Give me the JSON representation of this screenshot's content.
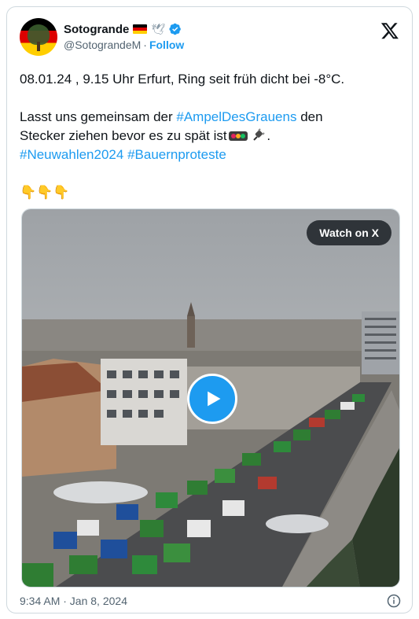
{
  "author": {
    "display_name": "Sotogrande",
    "handle": "@SotograndeM",
    "separator": "·",
    "follow_label": "Follow",
    "avatar_icon": "avatar-tree-german-flag",
    "flag_icon": "german-flag-emoji",
    "dove_icon": "dove-emoji",
    "verified_icon": "verified-badge-icon"
  },
  "tweet": {
    "line1": "08.01.24 , 9.15 Uhr Erfurt, Ring seit früh dicht bei -8°C.",
    "line2_pre": "Lasst uns gemeinsam der ",
    "line2_hashtag": "#AmpelDesGrauens",
    "line2_post": " den",
    "line3": "Stecker ziehen bevor es zu spät ist",
    "line3_end": ".",
    "hashtag1": "#Neuwahlen2024",
    "hashtag2": "#Bauernproteste",
    "traffic_light_icon": "traffic-light-emoji",
    "plug_icon": "electric-plug-emoji",
    "pointing_emoji": "👇👇👇"
  },
  "media": {
    "watch_label": "Watch on X",
    "play_icon": "play-icon"
  },
  "footer": {
    "timestamp": "9:34 AM · Jan 8, 2024",
    "info_icon": "info-icon"
  },
  "colors": {
    "accent": "#1d9bf0",
    "text": "#0f1419",
    "secondary": "#536471",
    "border": "#cfd9de"
  }
}
